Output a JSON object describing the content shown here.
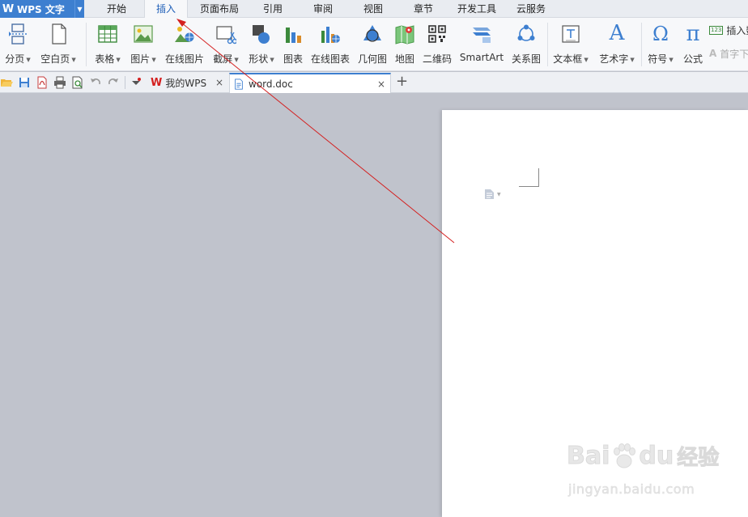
{
  "app": {
    "name": "WPS 文字",
    "logo_letter": "W"
  },
  "menu_tabs": [
    "开始",
    "插入",
    "页面布局",
    "引用",
    "审阅",
    "视图",
    "章节",
    "开发工具",
    "云服务"
  ],
  "active_tab": "插入",
  "ribbon": {
    "page_break": "分页",
    "blank_page": "空白页",
    "table": "表格",
    "picture": "图片",
    "online_picture": "在线图片",
    "screenshot": "截屏",
    "shapes": "形状",
    "chart": "图表",
    "online_chart": "在线图表",
    "geometry": "几何图",
    "map": "地图",
    "qrcode": "二维码",
    "smartart": "SmartArt",
    "relation": "关系图",
    "textbox": "文本框",
    "wordart": "艺术字",
    "symbol": "符号",
    "formula": "公式",
    "insert_number": "插入数",
    "drop_cap": "首字下",
    "number_badge": "123",
    "symbol_glyph": "Ω",
    "formula_glyph": "π",
    "wordart_glyph": "A"
  },
  "doc_tabs": [
    {
      "label": "我的WPS"
    },
    {
      "label": "word.doc"
    }
  ],
  "new_tab_glyph": "+",
  "close_glyph": "×",
  "watermark": {
    "brand": "Bai",
    "brand_suffix": "du",
    "brand_cn": "经验",
    "url": "jingyan.baidu.com"
  },
  "colors": {
    "accent": "#3d7fd0",
    "annotation_arrow": "#d42020",
    "workspace": "#c0c3cc"
  }
}
